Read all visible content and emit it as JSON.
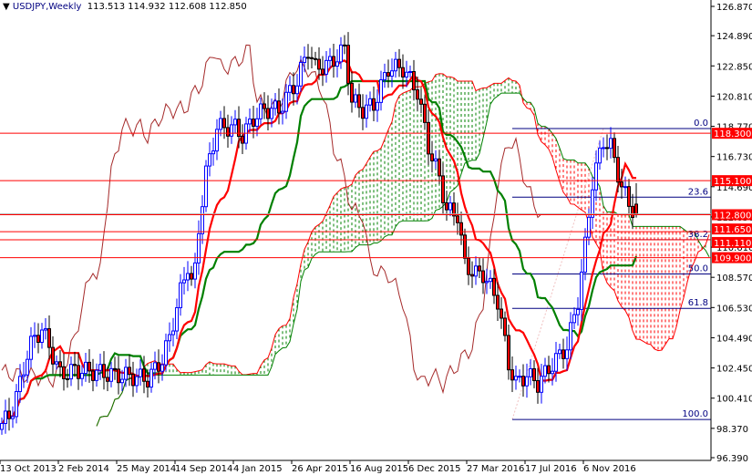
{
  "header": {
    "symbol_timeframe": "USDJPY,Weekly",
    "ohlc": "113.513 114.932 112.608 112.850"
  },
  "colors": {
    "bull_candle": "#0000ff",
    "bear_candle": "#ff0000",
    "tenkan": "#ff0000",
    "kijun": "#008000",
    "chikou": "#a52a2a",
    "cloud_up": "#008000",
    "cloud_down": "#ff0000",
    "level_line": "#ff0000",
    "fib_line": "#000080"
  },
  "chart_data": {
    "type": "candlestick",
    "title": "USDJPY,Weekly",
    "xlabel": "",
    "ylabel": "",
    "ylim": [
      96.39,
      126.87
    ],
    "weeks_total": 175,
    "y_ticks": [
      "126.870",
      "124.890",
      "122.850",
      "120.810",
      "118.770",
      "116.730",
      "114.690",
      "112.650",
      "110.610",
      "108.570",
      "106.530",
      "104.490",
      "102.450",
      "100.410",
      "98.370",
      "96.390"
    ],
    "x_ticks": [
      {
        "week": 0,
        "label": "13 Oct 2013"
      },
      {
        "week": 16,
        "label": "2 Feb 2014"
      },
      {
        "week": 32,
        "label": "25 May 2014"
      },
      {
        "week": 48,
        "label": "14 Sep 2014"
      },
      {
        "week": 64,
        "label": "4 Jan 2015"
      },
      {
        "week": 80,
        "label": "26 Apr 2015"
      },
      {
        "week": 96,
        "label": "16 Aug 2015"
      },
      {
        "week": 112,
        "label": "6 Dec 2015"
      },
      {
        "week": 128,
        "label": "27 Mar 2016"
      },
      {
        "week": 144,
        "label": "17 Jul 2016"
      },
      {
        "week": 160,
        "label": "6 Nov 2016"
      }
    ],
    "close_path": [
      [
        0,
        98.7
      ],
      [
        2.5,
        99.3
      ],
      [
        5,
        101.4
      ],
      [
        7.5,
        103.9
      ],
      [
        11,
        105.1
      ],
      [
        14,
        103.3
      ],
      [
        16,
        102.0
      ],
      [
        20,
        102.3
      ],
      [
        25,
        102.2
      ],
      [
        30,
        102.0
      ],
      [
        35,
        101.9
      ],
      [
        40,
        101.7
      ],
      [
        44,
        103.0
      ],
      [
        46,
        104.5
      ],
      [
        49,
        107.6
      ],
      [
        51,
        109.4
      ],
      [
        52.5,
        107.6
      ],
      [
        54,
        111.9
      ],
      [
        56,
        115.6
      ],
      [
        59,
        118.7
      ],
      [
        61,
        118.7
      ],
      [
        64,
        118.7
      ],
      [
        66,
        118.1
      ],
      [
        69,
        119.3
      ],
      [
        72,
        119.9
      ],
      [
        76,
        119.9
      ],
      [
        79,
        121.1
      ],
      [
        81,
        121.8
      ],
      [
        84,
        124.0
      ],
      [
        86,
        122.7
      ],
      [
        90,
        123.0
      ],
      [
        94,
        124.0
      ],
      [
        96,
        120.5
      ],
      [
        99,
        119.9
      ],
      [
        102,
        120.2
      ],
      [
        106,
        122.7
      ],
      [
        110,
        122.7
      ],
      [
        114,
        121.1
      ],
      [
        117,
        117.4
      ],
      [
        120,
        115.3
      ],
      [
        122,
        113.1
      ],
      [
        125,
        112.8
      ],
      [
        127,
        109.4
      ],
      [
        130,
        108.8
      ],
      [
        132,
        108.8
      ],
      [
        136,
        107.0
      ],
      [
        139,
        102.7
      ],
      [
        141,
        101.4
      ],
      [
        144,
        102.0
      ],
      [
        147,
        101.4
      ],
      [
        151,
        102.7
      ],
      [
        155,
        103.9
      ],
      [
        158,
        107.0
      ],
      [
        160,
        110.7
      ],
      [
        162,
        115.0
      ],
      [
        165,
        117.8
      ],
      [
        167,
        117.4
      ],
      [
        170,
        114.7
      ],
      [
        172,
        113.5
      ],
      [
        174,
        112.85
      ]
    ],
    "last_ohlc": {
      "open": 113.513,
      "high": 114.932,
      "low": 112.608,
      "close": 112.85
    },
    "horizontal_levels": [
      {
        "price": 118.3,
        "label": "118.300"
      },
      {
        "price": 115.1,
        "label": "115.100"
      },
      {
        "price": 112.8,
        "label": "112.800"
      },
      {
        "price": 111.65,
        "label": "111.650"
      },
      {
        "price": 111.11,
        "label": "111.110"
      },
      {
        "price": 109.9,
        "label": "109.900"
      }
    ],
    "fibonacci": {
      "start_week": 140,
      "high": 118.62,
      "low": 98.97,
      "levels": [
        {
          "ratio": 0.0,
          "label": "0.0"
        },
        {
          "ratio": 0.236,
          "label": "23.6"
        },
        {
          "ratio": 0.382,
          "label": "38.2"
        },
        {
          "ratio": 0.5,
          "label": "50.0"
        },
        {
          "ratio": 0.618,
          "label": "61.8"
        },
        {
          "ratio": 1.0,
          "label": "100.0"
        }
      ]
    },
    "indicators": [
      "Ichimoku Kinko Hyo (Tenkan, Kijun, Senkou Span A/B, Chikou)"
    ]
  }
}
